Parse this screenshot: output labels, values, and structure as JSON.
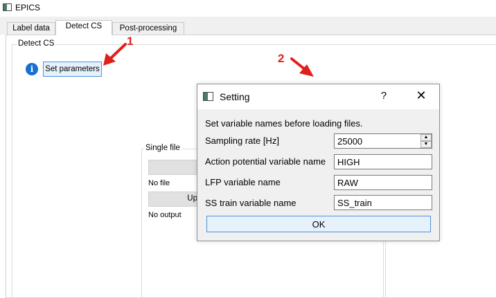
{
  "window": {
    "title": "EPICS",
    "icon": "app-window-icon"
  },
  "tabs": [
    {
      "label": "Label data",
      "active": false
    },
    {
      "label": "Detect CS",
      "active": true
    },
    {
      "label": "Post-processing",
      "active": false
    }
  ],
  "detect_group": {
    "title": "Detect CS",
    "info_icon": "info-icon",
    "set_parameters_label": "Set parameters"
  },
  "single_file": {
    "title": "Single file",
    "status_file": "No file",
    "button2_partial": "Up",
    "status_output": "No output"
  },
  "annotations": [
    {
      "number": "1",
      "color": "#e0201a"
    },
    {
      "number": "2",
      "color": "#e0201a"
    }
  ],
  "dialog": {
    "title": "Setting",
    "help_glyph": "?",
    "close_glyph": "✕",
    "instruction": "Set variable names before loading files.",
    "fields": [
      {
        "label": "Sampling rate [Hz]",
        "value": "25000",
        "kind": "spinbox"
      },
      {
        "label": "Action potential variable name",
        "value": "HIGH",
        "kind": "text"
      },
      {
        "label": "LFP variable name",
        "value": "RAW",
        "kind": "text"
      },
      {
        "label": "SS train variable name",
        "value": "SS_train",
        "kind": "text"
      }
    ],
    "ok_label": "OK"
  },
  "colors": {
    "accent": "#4d92d6",
    "button_hover": "#e5f1fb",
    "annotation": "#e0201a",
    "info": "#1a6fd0"
  }
}
